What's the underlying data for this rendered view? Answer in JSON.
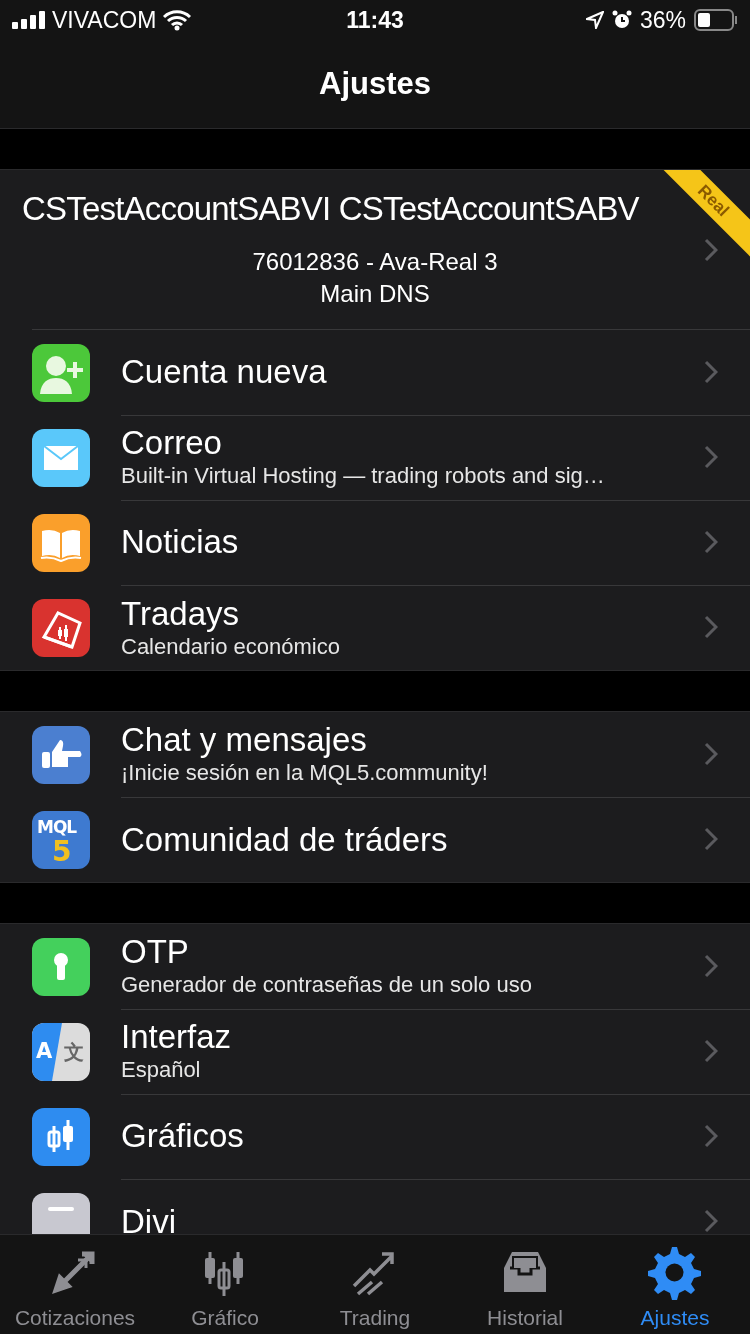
{
  "status_bar": {
    "carrier": "VIVACOM",
    "time": "11:43",
    "battery": "36%"
  },
  "header": {
    "title": "Ajustes"
  },
  "account": {
    "name": "CSTestAccountSABVI CSTestAccountSABV",
    "number": "76012836 - Ava-Real 3",
    "server": "Main DNS",
    "ribbon": "Real"
  },
  "sections": [
    {
      "rows": [
        {
          "title": "Cuenta nueva"
        },
        {
          "title": "Correo",
          "subtitle": "Built-in Virtual Hosting — trading robots and sig…"
        },
        {
          "title": "Noticias"
        },
        {
          "title": "Tradays",
          "subtitle": "Calendario económico"
        }
      ]
    },
    {
      "rows": [
        {
          "title": "Chat y mensajes",
          "subtitle": "¡Inicie sesión en la MQL5.community!"
        },
        {
          "title": "Comunidad de tráders",
          "icon_text": [
            "MQL",
            "5"
          ]
        }
      ]
    },
    {
      "rows": [
        {
          "title": "OTP",
          "subtitle": "Generador de contraseñas de un solo uso"
        },
        {
          "title": "Interfaz",
          "subtitle": "Español",
          "icon_text": [
            "A",
            "文"
          ]
        },
        {
          "title": "Gráficos"
        },
        {
          "title": "Divi"
        }
      ]
    }
  ],
  "tabs": [
    {
      "label": "Cotizaciones",
      "selected": false
    },
    {
      "label": "Gráfico",
      "selected": false
    },
    {
      "label": "Trading",
      "selected": false
    },
    {
      "label": "Historial",
      "selected": false
    },
    {
      "label": "Ajustes",
      "selected": true
    }
  ]
}
